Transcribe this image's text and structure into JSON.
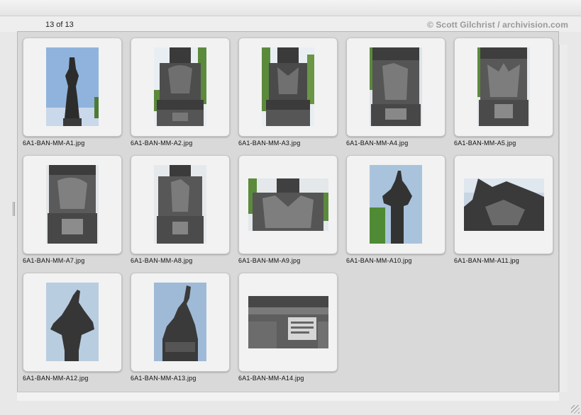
{
  "header": {
    "counter": "13 of 13",
    "copyright": "© Scott Gilchrist / archivision.com"
  },
  "thumbnails": [
    {
      "filename": "6A1-BAN-MM-A1.jpg",
      "icon": "statue-column-icon"
    },
    {
      "filename": "6A1-BAN-MM-A2.jpg",
      "icon": "relief-panel-icon"
    },
    {
      "filename": "6A1-BAN-MM-A3.jpg",
      "icon": "relief-panel-icon"
    },
    {
      "filename": "6A1-BAN-MM-A4.jpg",
      "icon": "relief-panel-icon"
    },
    {
      "filename": "6A1-BAN-MM-A5.jpg",
      "icon": "relief-panel-icon"
    },
    {
      "filename": "6A1-BAN-MM-A7.jpg",
      "icon": "relief-panel-icon"
    },
    {
      "filename": "6A1-BAN-MM-A8.jpg",
      "icon": "relief-panel-icon"
    },
    {
      "filename": "6A1-BAN-MM-A9.jpg",
      "icon": "relief-detail-icon"
    },
    {
      "filename": "6A1-BAN-MM-A10.jpg",
      "icon": "statue-column-icon"
    },
    {
      "filename": "6A1-BAN-MM-A11.jpg",
      "icon": "sculpture-detail-icon"
    },
    {
      "filename": "6A1-BAN-MM-A12.jpg",
      "icon": "statue-top-icon"
    },
    {
      "filename": "6A1-BAN-MM-A13.jpg",
      "icon": "statue-top-icon"
    },
    {
      "filename": "6A1-BAN-MM-A14.jpg",
      "icon": "inscription-base-icon"
    }
  ]
}
